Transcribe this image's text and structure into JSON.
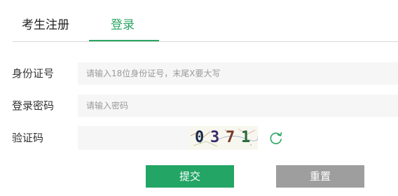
{
  "tabs": [
    {
      "label": "考生注册",
      "active": false
    },
    {
      "label": "登录",
      "active": true
    }
  ],
  "form": {
    "id_label": "身份证号",
    "id_placeholder": "请输入18位身份证号，末尾X要大写",
    "password_label": "登录密码",
    "password_placeholder": "请输入密码",
    "captcha_label": "验证码",
    "captcha_value": "",
    "captcha_digits": [
      "0",
      "3",
      "7",
      "1"
    ],
    "refresh_icon": "refresh-icon"
  },
  "buttons": {
    "submit": "提交",
    "reset": "重置"
  },
  "colors": {
    "accent": "#2aa561",
    "submit_bg": "#22a565",
    "reset_bg": "#9e9e9e",
    "field_bg": "#f6f6f6"
  }
}
